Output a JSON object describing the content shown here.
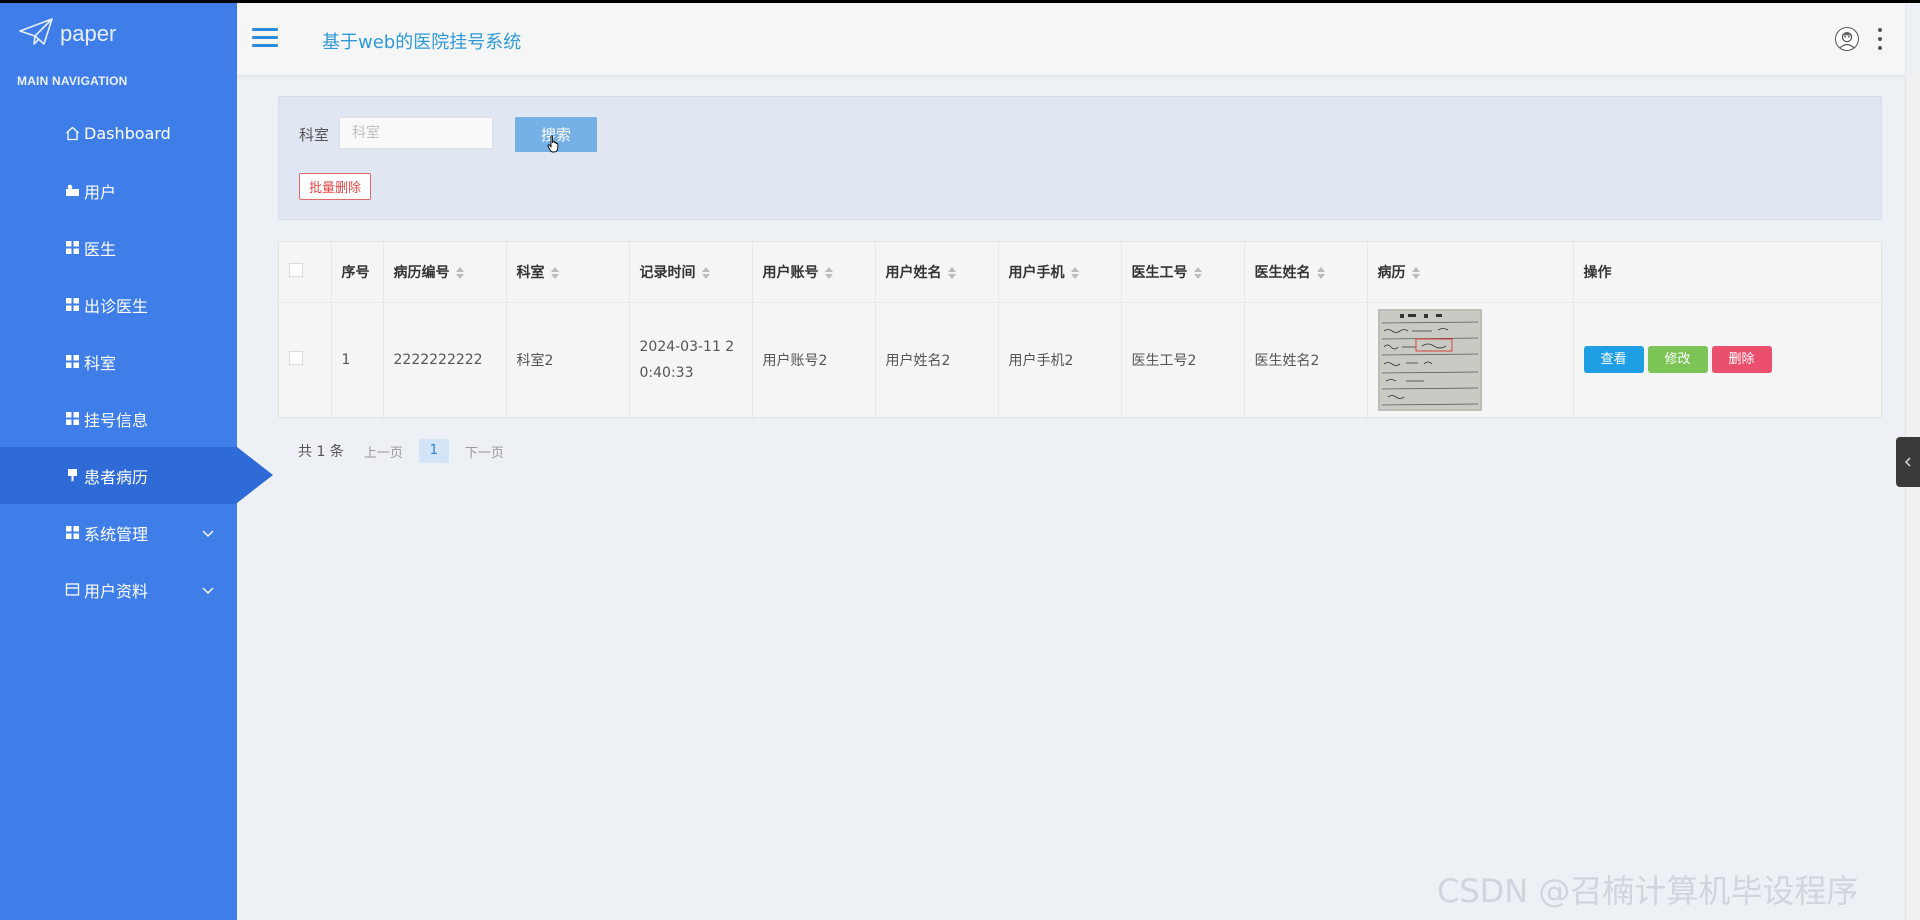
{
  "brand": {
    "logo_text": "paper"
  },
  "sidebar": {
    "header": "MAIN NAVIGATION",
    "items": [
      {
        "label": "Dashboard",
        "icon": "home-icon"
      },
      {
        "label": "用户",
        "icon": "user-card-icon"
      },
      {
        "label": "医生",
        "icon": "grid-icon"
      },
      {
        "label": "出诊医生",
        "icon": "grid-icon"
      },
      {
        "label": "科室",
        "icon": "grid-icon"
      },
      {
        "label": "挂号信息",
        "icon": "grid-icon"
      },
      {
        "label": "患者病历",
        "icon": "bookmark-icon",
        "active": true
      },
      {
        "label": "系统管理",
        "icon": "grid-icon",
        "expandable": true
      },
      {
        "label": "用户资料",
        "icon": "form-icon",
        "expandable": true
      }
    ]
  },
  "header": {
    "title": "基于web的医院挂号系统"
  },
  "search": {
    "label": "科室",
    "placeholder": "科室",
    "button": "搜索",
    "batch_delete": "批量删除"
  },
  "table": {
    "columns": [
      "序号",
      "病历编号",
      "科室",
      "记录时间",
      "用户账号",
      "用户姓名",
      "用户手机",
      "医生工号",
      "医生姓名",
      "病历",
      "操作"
    ],
    "rows": [
      {
        "index": "1",
        "record_no": "2222222222",
        "department": "科室2",
        "record_time": "2024-03-11 20:40:33",
        "account": "用户账号2",
        "user_name": "用户姓名2",
        "phone": "用户手机2",
        "doctor_no": "医生工号2",
        "doctor_name": "医生姓名2"
      }
    ],
    "actions": {
      "view": "查看",
      "edit": "修改",
      "delete": "删除"
    }
  },
  "pagination": {
    "total": "共 1 条",
    "prev": "上一页",
    "current": "1",
    "next": "下一页"
  },
  "watermark": "CSDN @召楠计算机毕设程序",
  "colors": {
    "sidebar": "#3f7ee8",
    "sidebar_active": "#2f6bd6",
    "title": "#2f9ad7",
    "view": "#1e9fe3",
    "edit": "#7dc456",
    "delete": "#ea4f6d"
  }
}
